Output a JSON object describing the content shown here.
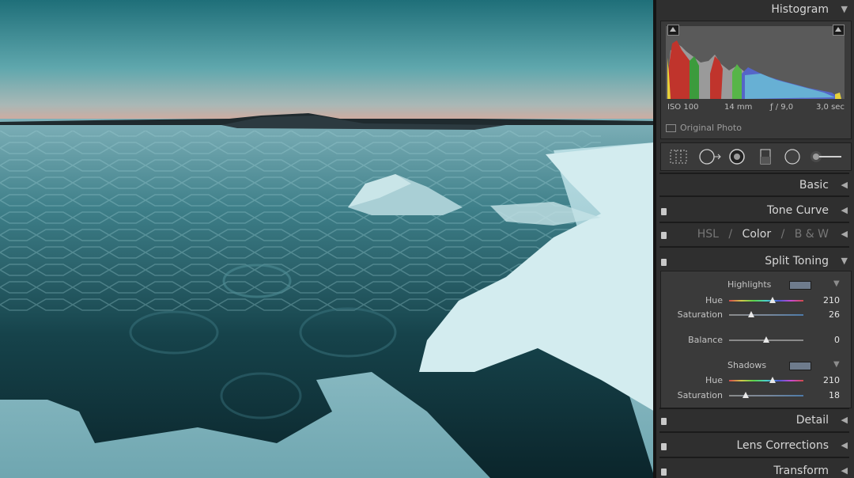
{
  "photo": {
    "description_name": "frozen sea at dusk"
  },
  "panel": {
    "histogram": {
      "title": "Histogram",
      "iso": "ISO 100",
      "focal": "14 mm",
      "aperture": "ƒ / 9,0",
      "shutter": "3,0 sec",
      "original_photo": "Original Photo"
    },
    "tools": [
      "grid-crop-icon",
      "spot-removal-icon",
      "red-eye-icon",
      "graduated-filter-icon",
      "radial-filter-icon",
      "adjustment-brush-icon"
    ],
    "sections": {
      "basic": "Basic",
      "tone_curve": "Tone Curve",
      "hsl": "HSL",
      "slash1": "/",
      "color": "Color",
      "slash2": "/",
      "bw": "B & W",
      "split_toning": "Split Toning",
      "detail": "Detail",
      "lens": "Lens Corrections",
      "transform": "Transform"
    },
    "split_toning": {
      "highlights_label": "Highlights",
      "highlights_color": "#6e7b8c",
      "hl_hue_label": "Hue",
      "hl_hue": "210",
      "hl_hue_frac": 0.58,
      "hl_sat_label": "Saturation",
      "hl_sat": "26",
      "hl_sat_frac": 0.3,
      "balance_label": "Balance",
      "balance": "0",
      "balance_frac": 0.5,
      "shadows_label": "Shadows",
      "shadows_color": "#6e7b8c",
      "sh_hue_label": "Hue",
      "sh_hue": "210",
      "sh_hue_frac": 0.58,
      "sh_sat_label": "Saturation",
      "sh_sat": "18",
      "sh_sat_frac": 0.22
    }
  }
}
